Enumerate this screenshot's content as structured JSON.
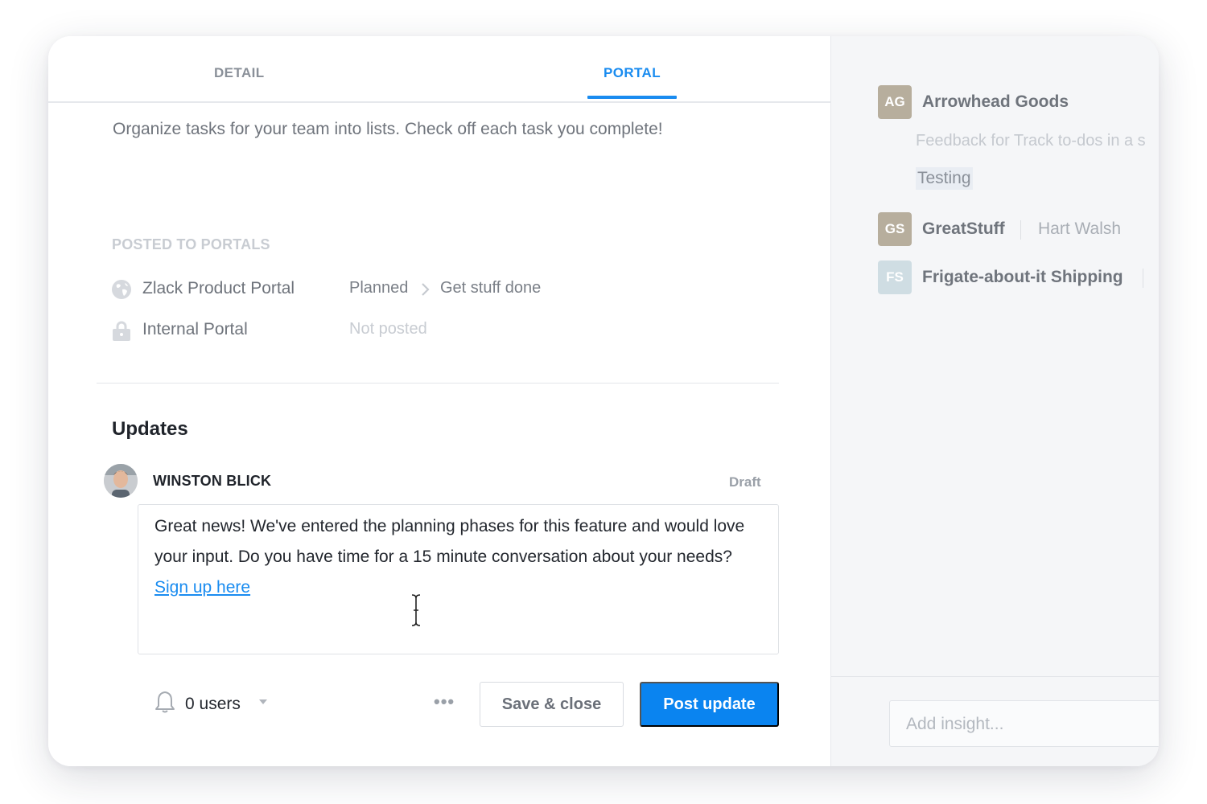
{
  "tabs": {
    "detail": "DETAIL",
    "portal": "PORTAL"
  },
  "description": "Organize tasks for your team into lists. Check off each task you complete!",
  "posted_to_portals": {
    "label": "POSTED TO PORTALS",
    "portals": [
      {
        "name": "Zlack Product Portal",
        "icon": "globe-icon",
        "status": "Planned",
        "column": "Get stuff done"
      },
      {
        "name": "Internal Portal",
        "icon": "lock-icon",
        "status": "Not posted"
      }
    ]
  },
  "updates": {
    "title": "Updates",
    "author": "WINSTON BLICK",
    "state": "Draft",
    "message": "Great news! We've entered the planning phases for this feature and would love your input. Do you have time for a 15 minute conversation about your needs?",
    "link_text": "Sign up here",
    "notify_count": "0 users",
    "more_label": "•••",
    "save_label": "Save & close",
    "post_label": "Post update"
  },
  "sidebar": {
    "accounts": [
      {
        "initials": "AG",
        "name": "Arrowhead Goods",
        "color": "#b7ae9d"
      },
      {
        "initials": "GS",
        "name": "GreatStuff",
        "contact": "Hart Walsh",
        "color": "#b7ae9d"
      },
      {
        "initials": "FS",
        "name": "Frigate-about-it Shipping",
        "color": "#cfdde3"
      }
    ],
    "feedback": "Feedback for Track to-dos in a s",
    "tag": "Testing",
    "insight_placeholder": "Add insight..."
  },
  "colors": {
    "accent": "#0a84f0",
    "tab_active": "#1a8cf0"
  }
}
